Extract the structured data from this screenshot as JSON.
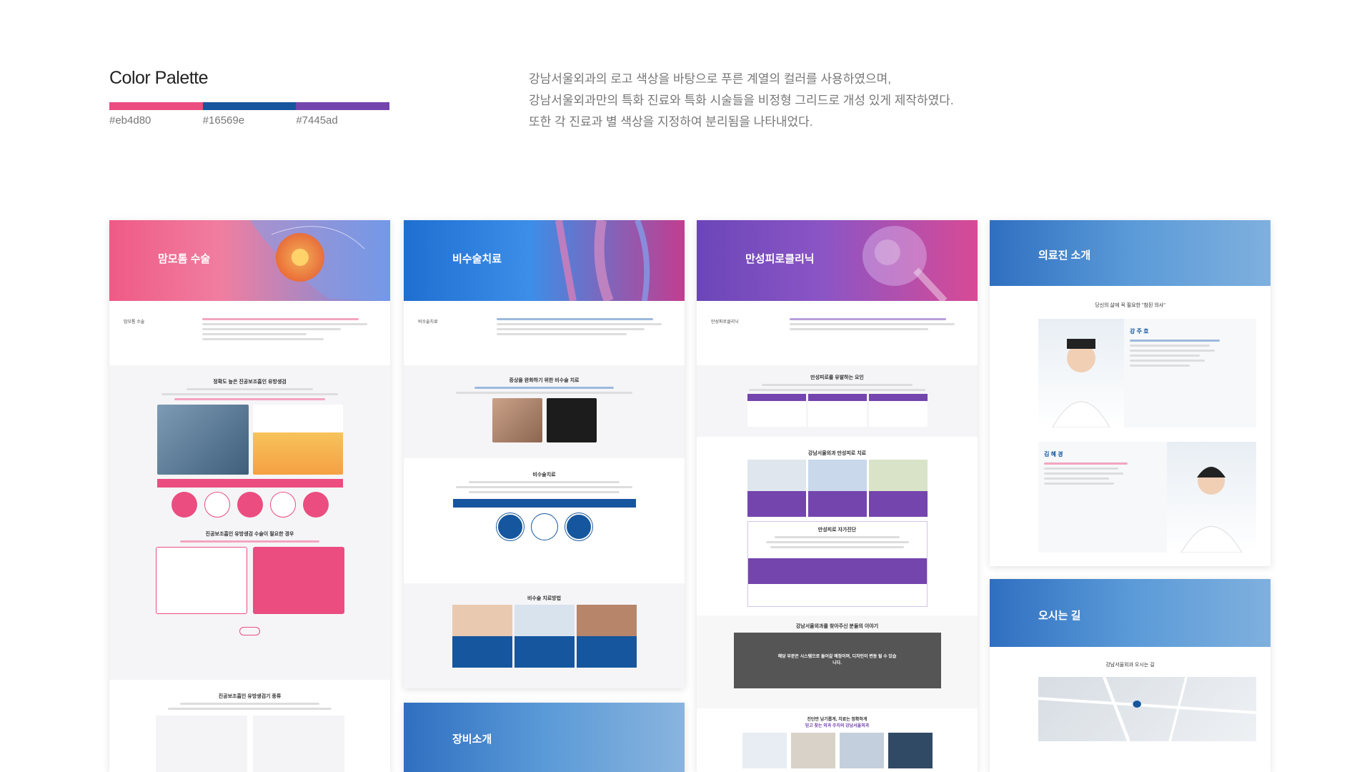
{
  "header": {
    "title": "Color Palette",
    "description_lines": [
      "강남서울외과의 로고 색상을 바탕으로 푸른 계열의  컬러를 사용하였으며,",
      "강남서울외과만의 특화 진료와 특화 시술들을 비정형 그리드로 개성 있게 제작하였다.",
      "또한 각 진료과 별 색상을 지정하여 분리됨을 나타내었다."
    ]
  },
  "palette": [
    {
      "hex": "#eb4d80",
      "label": "#eb4d80"
    },
    {
      "hex": "#16569e",
      "label": "#16569e"
    },
    {
      "hex": "#7445ad",
      "label": "#7445ad"
    }
  ],
  "pages": {
    "breast": {
      "hero_title": "맘모톰 수술",
      "section_label": "맘모톰 수술",
      "sec1_title": "정확도 높은 진공보조흡인 유방생검",
      "sec2_title": "진공보조흡인 유방생검 수술이 필요한 경우",
      "sec3_title": "진공보조흡인 유방생검기 종류"
    },
    "varicose": {
      "hero_title": "비수술치료",
      "section_label": "비수술치료",
      "sec1_title": "증상을 완화하기 위한 비수술 치료",
      "sec2_title": "비수술치료",
      "sec3_title": "비수술 치료방법"
    },
    "equipment": {
      "hero_title": "장비소개"
    },
    "fatigue": {
      "hero_title": "만성피로클리닉",
      "section_label": "만성피로클리닉",
      "sec1_title": "만성피로를 유발하는 요인",
      "sec2_title": "강남서울외과 만성피로 치료",
      "sec3_title": "만성피로 자가진단",
      "sec4_title": "강남서울외과를 찾아주신 분들의 이야기",
      "review_text": "해당 부분은 시스템으로 들어갈 예정이며, 디자인이 변동 될 수 있습니다.",
      "bottom_line1": "진단만 남기롭게, 치료는 정확하게",
      "bottom_line2": "믿고 찾는 외과 주치의 강남서울외과"
    },
    "doctors": {
      "hero_title": "의료진 소개",
      "intro": "당신의 삶에 꼭 필요한 \"참된 의사\"",
      "doctor1": "강 주 호",
      "doctor2": "김 혜 경"
    },
    "directions": {
      "hero_title": "오시는 길",
      "subtitle": "강남서울외과 오시는 길"
    }
  },
  "colors": {
    "pink": "#eb4d80",
    "blue": "#16569e",
    "purple": "#7445ad"
  }
}
